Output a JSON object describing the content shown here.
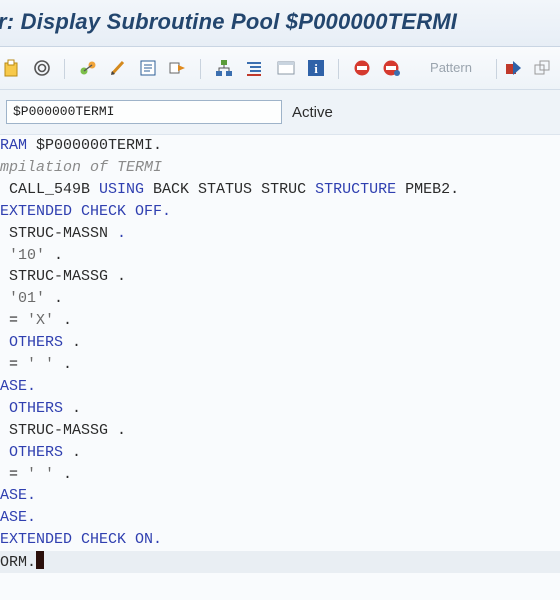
{
  "window": {
    "title": "r: Display Subroutine Pool $P000000TERMI"
  },
  "toolbar": {
    "icons": [
      "new-object-icon",
      "activate-icon",
      "where-used-icon",
      "edit-pencil-icon",
      "insert-statement-icon",
      "navigate-icon",
      "hierarchy-icon",
      "indent-icon",
      "window-icon",
      "info-icon",
      "breakpoint-icon",
      "session-breakpoint-icon",
      "arrow-icon",
      "more-icon"
    ],
    "pattern_label": "Pattern"
  },
  "object": {
    "name": "$P000000TERMI",
    "status": "Active"
  },
  "editor": {
    "lines": [
      [
        {
          "t": "kw",
          "v": "RAM "
        },
        {
          "t": "tx",
          "v": "$P000000TERMI."
        }
      ],
      [
        {
          "t": "cm",
          "v": "mpilation of TERMI"
        }
      ],
      [
        {
          "t": "tx",
          "v": " CALL_549B "
        },
        {
          "t": "kw",
          "v": "USING "
        },
        {
          "t": "tx",
          "v": "BACK STATUS STRUC "
        },
        {
          "t": "kw",
          "v": "STRUCTURE "
        },
        {
          "t": "tx",
          "v": "PMEB2."
        }
      ],
      [
        {
          "t": "kw",
          "v": "EXTENDED CHECK OFF."
        }
      ],
      [
        {
          "t": "tx",
          "v": " STRUC-MASSN "
        },
        {
          "t": "kw",
          "v": "."
        }
      ],
      [
        {
          "t": "lit",
          "v": " '10' "
        },
        {
          "t": "tx",
          "v": "."
        }
      ],
      [
        {
          "t": "tx",
          "v": " STRUC-MASSG ."
        }
      ],
      [
        {
          "t": "lit",
          "v": " '01' "
        },
        {
          "t": "tx",
          "v": "."
        }
      ],
      [
        {
          "t": "tx",
          "v": " = "
        },
        {
          "t": "lit",
          "v": "'X' "
        },
        {
          "t": "tx",
          "v": "."
        }
      ],
      [
        {
          "t": "kw",
          "v": " OTHERS "
        },
        {
          "t": "tx",
          "v": "."
        }
      ],
      [
        {
          "t": "tx",
          "v": " = "
        },
        {
          "t": "lit",
          "v": "' ' "
        },
        {
          "t": "tx",
          "v": "."
        }
      ],
      [
        {
          "t": "kw",
          "v": "ASE."
        }
      ],
      [
        {
          "t": "kw",
          "v": " OTHERS "
        },
        {
          "t": "tx",
          "v": "."
        }
      ],
      [
        {
          "t": "tx",
          "v": " STRUC-MASSG ."
        }
      ],
      [
        {
          "t": "kw",
          "v": " OTHERS "
        },
        {
          "t": "tx",
          "v": "."
        }
      ],
      [
        {
          "t": "tx",
          "v": " = "
        },
        {
          "t": "lit",
          "v": "' ' "
        },
        {
          "t": "tx",
          "v": "."
        }
      ],
      [
        {
          "t": "kw",
          "v": "ASE."
        }
      ],
      [
        {
          "t": "kw",
          "v": "ASE."
        }
      ],
      [
        {
          "t": "kw",
          "v": "EXTENDED CHECK ON."
        }
      ],
      [
        {
          "t": "tx",
          "v": "ORM."
        }
      ]
    ]
  }
}
